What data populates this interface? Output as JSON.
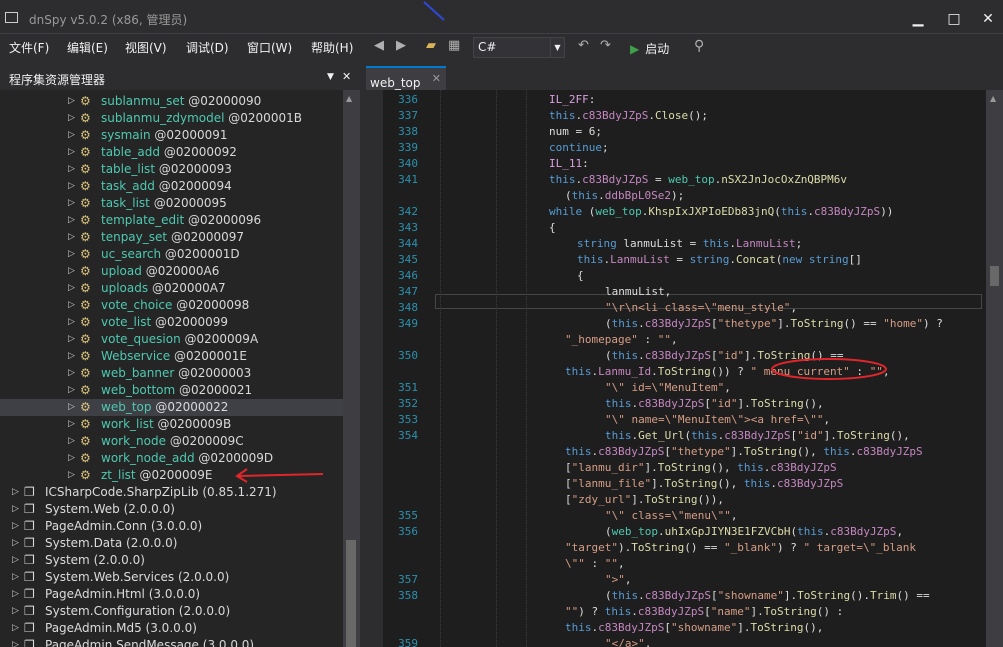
{
  "window": {
    "title": "dnSpy v5.0.2 (x86, 管理员)",
    "minimize": "▁",
    "maximize": "□",
    "close": "✕"
  },
  "menu": [
    "文件(F)",
    "编辑(E)",
    "视图(V)",
    "调试(D)",
    "窗口(W)",
    "帮助(H)"
  ],
  "toolbar": {
    "language_value": "C#",
    "start_label": "启动"
  },
  "left_panel": {
    "title": "程序集资源管理器",
    "pin": "▼",
    "close": "✕",
    "tree": [
      {
        "name": "sublanmu_set",
        "token": "@02000090",
        "kind": "class"
      },
      {
        "name": "sublanmu_zdymodel",
        "token": "@0200001B",
        "kind": "class"
      },
      {
        "name": "sysmain",
        "token": "@02000091",
        "kind": "class"
      },
      {
        "name": "table_add",
        "token": "@02000092",
        "kind": "class"
      },
      {
        "name": "table_list",
        "token": "@02000093",
        "kind": "class"
      },
      {
        "name": "task_add",
        "token": "@02000094",
        "kind": "class"
      },
      {
        "name": "task_list",
        "token": "@02000095",
        "kind": "class"
      },
      {
        "name": "template_edit",
        "token": "@02000096",
        "kind": "class"
      },
      {
        "name": "tenpay_set",
        "token": "@02000097",
        "kind": "class"
      },
      {
        "name": "uc_search",
        "token": "@0200001D",
        "kind": "class"
      },
      {
        "name": "upload",
        "token": "@020000A6",
        "kind": "class"
      },
      {
        "name": "uploads",
        "token": "@020000A7",
        "kind": "class"
      },
      {
        "name": "vote_choice",
        "token": "@02000098",
        "kind": "class"
      },
      {
        "name": "vote_list",
        "token": "@02000099",
        "kind": "class"
      },
      {
        "name": "vote_quesion",
        "token": "@0200009A",
        "kind": "class"
      },
      {
        "name": "Webservice",
        "token": "@0200001E",
        "kind": "class"
      },
      {
        "name": "web_banner",
        "token": "@02000003",
        "kind": "class"
      },
      {
        "name": "web_bottom",
        "token": "@02000021",
        "kind": "class"
      },
      {
        "name": "web_top",
        "token": "@02000022",
        "kind": "class",
        "selected": true
      },
      {
        "name": "work_list",
        "token": "@0200009B",
        "kind": "class"
      },
      {
        "name": "work_node",
        "token": "@0200009C",
        "kind": "class"
      },
      {
        "name": "work_node_add",
        "token": "@0200009D",
        "kind": "class"
      },
      {
        "name": "zt_list",
        "token": "@0200009E",
        "kind": "class"
      },
      {
        "name": "ICSharpCode.SharpZipLib",
        "token": "(0.85.1.271)",
        "kind": "assembly"
      },
      {
        "name": "System.Web",
        "token": "(2.0.0.0)",
        "kind": "assembly"
      },
      {
        "name": "PageAdmin.Conn",
        "token": "(3.0.0.0)",
        "kind": "assembly"
      },
      {
        "name": "System.Data",
        "token": "(2.0.0.0)",
        "kind": "assembly"
      },
      {
        "name": "System",
        "token": "(2.0.0.0)",
        "kind": "assembly"
      },
      {
        "name": "System.Web.Services",
        "token": "(2.0.0.0)",
        "kind": "assembly"
      },
      {
        "name": "PageAdmin.Html",
        "token": "(3.0.0.0)",
        "kind": "assembly"
      },
      {
        "name": "System.Configuration",
        "token": "(2.0.0.0)",
        "kind": "assembly"
      },
      {
        "name": "PageAdmin.Md5",
        "token": "(3.0.0.0)",
        "kind": "assembly"
      },
      {
        "name": "PageAdmin.SendMessage",
        "token": "(3.0.0.0)",
        "kind": "assembly"
      }
    ]
  },
  "editor": {
    "tab_label": "web_top",
    "tab_close": "✕",
    "lines": [
      {
        "n": "336",
        "i": 0,
        "t": [
          [
            "lbl-c",
            "IL_2FF"
          ],
          [
            "pl",
            ":"
          ]
        ]
      },
      {
        "n": "337",
        "i": 0,
        "t": [
          [
            "kw",
            "this"
          ],
          [
            "pl",
            "."
          ],
          [
            "fld",
            "c83BdyJZpS"
          ],
          [
            "pl",
            "."
          ],
          [
            "mth",
            "Close"
          ],
          [
            "pl",
            "();"
          ]
        ]
      },
      {
        "n": "338",
        "i": 0,
        "t": [
          [
            "pl",
            "num = 6;"
          ]
        ]
      },
      {
        "n": "339",
        "i": 0,
        "t": [
          [
            "kw",
            "continue"
          ],
          [
            "pl",
            ";"
          ]
        ]
      },
      {
        "n": "340",
        "i": 0,
        "t": [
          [
            "lbl-c",
            "IL_11"
          ],
          [
            "pl",
            ":"
          ]
        ]
      },
      {
        "n": "341",
        "i": 0,
        "t": [
          [
            "kw",
            "this"
          ],
          [
            "pl",
            "."
          ],
          [
            "fld",
            "c83BdyJZpS"
          ],
          [
            "pl",
            " = "
          ],
          [
            "typ",
            "web_top"
          ],
          [
            "pl",
            "."
          ],
          [
            "mth",
            "nSX2JnJocOxZnQBPM6v"
          ]
        ]
      },
      {
        "n": "",
        "i": 1,
        "t": [
          [
            "pl",
            "("
          ],
          [
            "kw",
            "this"
          ],
          [
            "pl",
            "."
          ],
          [
            "fld",
            "ddbBpL0Se2"
          ],
          [
            "pl",
            ");"
          ]
        ]
      },
      {
        "n": "342",
        "i": 0,
        "t": [
          [
            "kw",
            "while"
          ],
          [
            "pl",
            " ("
          ],
          [
            "typ",
            "web_top"
          ],
          [
            "pl",
            "."
          ],
          [
            "mth",
            "KhspIxJXPIoEDb83jnQ"
          ],
          [
            "pl",
            "("
          ],
          [
            "kw",
            "this"
          ],
          [
            "pl",
            "."
          ],
          [
            "fld",
            "c83BdyJZpS"
          ],
          [
            "pl",
            "))"
          ]
        ]
      },
      {
        "n": "343",
        "i": 0,
        "t": [
          [
            "pl",
            "{"
          ]
        ]
      },
      {
        "n": "344",
        "i": 2,
        "t": [
          [
            "kw",
            "string"
          ],
          [
            "pl",
            " lanmuList = "
          ],
          [
            "kw",
            "this"
          ],
          [
            "pl",
            "."
          ],
          [
            "fld",
            "LanmuList"
          ],
          [
            "pl",
            ";"
          ]
        ]
      },
      {
        "n": "345",
        "i": 2,
        "t": [
          [
            "kw",
            "this"
          ],
          [
            "pl",
            "."
          ],
          [
            "fld",
            "LanmuList"
          ],
          [
            "pl",
            " = "
          ],
          [
            "kw",
            "string"
          ],
          [
            "pl",
            "."
          ],
          [
            "mth",
            "Concat"
          ],
          [
            "pl",
            "("
          ],
          [
            "kw",
            "new"
          ],
          [
            "pl",
            " "
          ],
          [
            "kw",
            "string"
          ],
          [
            "pl",
            "[]"
          ]
        ]
      },
      {
        "n": "346",
        "i": 2,
        "t": [
          [
            "pl",
            "{"
          ]
        ]
      },
      {
        "n": "347",
        "i": 4,
        "t": [
          [
            "pl",
            "lanmuList,"
          ]
        ]
      },
      {
        "n": "348",
        "i": 4,
        "t": [
          [
            "str",
            "\"\\r\\n<li class=\\\"menu_style\""
          ],
          [
            "pl",
            ","
          ]
        ]
      },
      {
        "n": "349",
        "i": 4,
        "t": [
          [
            "pl",
            "("
          ],
          [
            "kw",
            "this"
          ],
          [
            "pl",
            "."
          ],
          [
            "fld",
            "c83BdyJZpS"
          ],
          [
            "pl",
            "["
          ],
          [
            "str",
            "\"thetype\""
          ],
          [
            "pl",
            "]."
          ],
          [
            "mth",
            "ToString"
          ],
          [
            "pl",
            "() == "
          ],
          [
            "str",
            "\"home\""
          ],
          [
            "pl",
            ") ?"
          ]
        ]
      },
      {
        "n": "",
        "i": 1,
        "t": [
          [
            "str",
            "\"_homepage\""
          ],
          [
            "pl",
            " : "
          ],
          [
            "str",
            "\"\""
          ],
          [
            "pl",
            ","
          ]
        ]
      },
      {
        "n": "350",
        "i": 4,
        "t": [
          [
            "pl",
            "("
          ],
          [
            "kw",
            "this"
          ],
          [
            "pl",
            "."
          ],
          [
            "fld",
            "c83BdyJZpS"
          ],
          [
            "pl",
            "["
          ],
          [
            "str",
            "\"id\""
          ],
          [
            "pl",
            "]."
          ],
          [
            "mth",
            "ToString"
          ],
          [
            "pl",
            "() =="
          ]
        ]
      },
      {
        "n": "",
        "i": 1,
        "t": [
          [
            "kw",
            "this"
          ],
          [
            "pl",
            "."
          ],
          [
            "fld",
            "Lanmu_Id"
          ],
          [
            "pl",
            "."
          ],
          [
            "mth",
            "ToString"
          ],
          [
            "pl",
            "()) ? "
          ],
          [
            "str",
            "\" menu_current\""
          ],
          [
            "pl",
            " : "
          ],
          [
            "str",
            "\"\""
          ],
          [
            "pl",
            ","
          ]
        ]
      },
      {
        "n": "351",
        "i": 4,
        "t": [
          [
            "str",
            "\"\\\" id=\\\"MenuItem\""
          ],
          [
            "pl",
            ","
          ]
        ]
      },
      {
        "n": "352",
        "i": 4,
        "t": [
          [
            "kw",
            "this"
          ],
          [
            "pl",
            "."
          ],
          [
            "fld",
            "c83BdyJZpS"
          ],
          [
            "pl",
            "["
          ],
          [
            "str",
            "\"id\""
          ],
          [
            "pl",
            "]."
          ],
          [
            "mth",
            "ToString"
          ],
          [
            "pl",
            "(),"
          ]
        ]
      },
      {
        "n": "353",
        "i": 4,
        "t": [
          [
            "str",
            "\"\\\" name=\\\"MenuItem\\\"><a href=\\\"\""
          ],
          [
            "pl",
            ","
          ]
        ]
      },
      {
        "n": "354",
        "i": 4,
        "t": [
          [
            "kw",
            "this"
          ],
          [
            "pl",
            "."
          ],
          [
            "mth",
            "Get_Url"
          ],
          [
            "pl",
            "("
          ],
          [
            "kw",
            "this"
          ],
          [
            "pl",
            "."
          ],
          [
            "fld",
            "c83BdyJZpS"
          ],
          [
            "pl",
            "["
          ],
          [
            "str",
            "\"id\""
          ],
          [
            "pl",
            "]."
          ],
          [
            "mth",
            "ToString"
          ],
          [
            "pl",
            "(),"
          ]
        ]
      },
      {
        "n": "",
        "i": 1,
        "t": [
          [
            "kw",
            "this"
          ],
          [
            "pl",
            "."
          ],
          [
            "fld",
            "c83BdyJZpS"
          ],
          [
            "pl",
            "["
          ],
          [
            "str",
            "\"thetype\""
          ],
          [
            "pl",
            "]."
          ],
          [
            "mth",
            "ToString"
          ],
          [
            "pl",
            "(), "
          ],
          [
            "kw",
            "this"
          ],
          [
            "pl",
            "."
          ],
          [
            "fld",
            "c83BdyJZpS"
          ]
        ]
      },
      {
        "n": "",
        "i": 1,
        "t": [
          [
            "pl",
            "["
          ],
          [
            "str",
            "\"lanmu_dir\""
          ],
          [
            "pl",
            "]."
          ],
          [
            "mth",
            "ToString"
          ],
          [
            "pl",
            "(), "
          ],
          [
            "kw",
            "this"
          ],
          [
            "pl",
            "."
          ],
          [
            "fld",
            "c83BdyJZpS"
          ]
        ]
      },
      {
        "n": "",
        "i": 1,
        "t": [
          [
            "pl",
            "["
          ],
          [
            "str",
            "\"lanmu_file\""
          ],
          [
            "pl",
            "]."
          ],
          [
            "mth",
            "ToString"
          ],
          [
            "pl",
            "(), "
          ],
          [
            "kw",
            "this"
          ],
          [
            "pl",
            "."
          ],
          [
            "fld",
            "c83BdyJZpS"
          ]
        ]
      },
      {
        "n": "",
        "i": 1,
        "t": [
          [
            "pl",
            "["
          ],
          [
            "str",
            "\"zdy_url\""
          ],
          [
            "pl",
            "]."
          ],
          [
            "mth",
            "ToString"
          ],
          [
            "pl",
            "()),"
          ]
        ]
      },
      {
        "n": "355",
        "i": 4,
        "t": [
          [
            "str",
            "\"\\\" class=\\\"menu\\\"\""
          ],
          [
            "pl",
            ","
          ]
        ]
      },
      {
        "n": "356",
        "i": 4,
        "t": [
          [
            "pl",
            "("
          ],
          [
            "typ",
            "web_top"
          ],
          [
            "pl",
            "."
          ],
          [
            "mth",
            "uhIxGpJIYN3E1FZVCbH"
          ],
          [
            "pl",
            "("
          ],
          [
            "kw",
            "this"
          ],
          [
            "pl",
            "."
          ],
          [
            "fld",
            "c83BdyJZpS"
          ],
          [
            "pl",
            ","
          ]
        ]
      },
      {
        "n": "",
        "i": 1,
        "t": [
          [
            "str",
            "\"target\""
          ],
          [
            "pl",
            ")."
          ],
          [
            "mth",
            "ToString"
          ],
          [
            "pl",
            "() == "
          ],
          [
            "str",
            "\"_blank\""
          ],
          [
            "pl",
            ") ? "
          ],
          [
            "str",
            "\" target=\\\"_blank"
          ]
        ]
      },
      {
        "n": "",
        "i": 1,
        "t": [
          [
            "str",
            "\\\"\""
          ],
          [
            "pl",
            " : "
          ],
          [
            "str",
            "\"\""
          ],
          [
            "pl",
            ","
          ]
        ]
      },
      {
        "n": "357",
        "i": 4,
        "t": [
          [
            "str",
            "\">\""
          ],
          [
            "pl",
            ","
          ]
        ]
      },
      {
        "n": "358",
        "i": 4,
        "t": [
          [
            "pl",
            "("
          ],
          [
            "kw",
            "this"
          ],
          [
            "pl",
            "."
          ],
          [
            "fld",
            "c83BdyJZpS"
          ],
          [
            "pl",
            "["
          ],
          [
            "str",
            "\"showname\""
          ],
          [
            "pl",
            "]."
          ],
          [
            "mth",
            "ToString"
          ],
          [
            "pl",
            "()."
          ],
          [
            "mth",
            "Trim"
          ],
          [
            "pl",
            "() =="
          ]
        ]
      },
      {
        "n": "",
        "i": 1,
        "t": [
          [
            "str",
            "\"\""
          ],
          [
            "pl",
            ") ? "
          ],
          [
            "kw",
            "this"
          ],
          [
            "pl",
            "."
          ],
          [
            "fld",
            "c83BdyJZpS"
          ],
          [
            "pl",
            "["
          ],
          [
            "str",
            "\"name\""
          ],
          [
            "pl",
            "]."
          ],
          [
            "mth",
            "ToString"
          ],
          [
            "pl",
            "() :"
          ]
        ]
      },
      {
        "n": "",
        "i": 1,
        "t": [
          [
            "kw",
            "this"
          ],
          [
            "pl",
            "."
          ],
          [
            "fld",
            "c83BdyJZpS"
          ],
          [
            "pl",
            "["
          ],
          [
            "str",
            "\"showname\""
          ],
          [
            "pl",
            "]."
          ],
          [
            "mth",
            "ToString"
          ],
          [
            "pl",
            "(),"
          ]
        ]
      },
      {
        "n": "359",
        "i": 4,
        "t": [
          [
            "str",
            "\"</a>\""
          ],
          [
            "pl",
            ","
          ]
        ]
      }
    ]
  }
}
